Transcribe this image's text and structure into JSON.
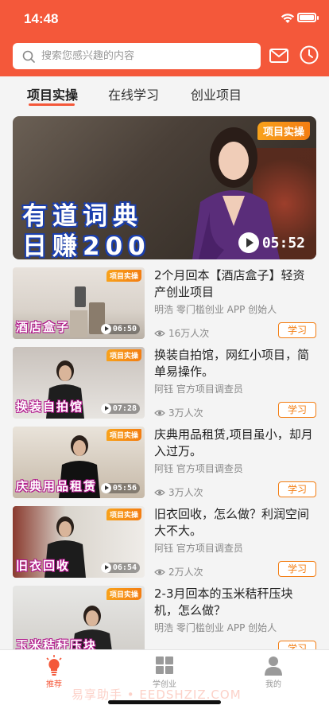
{
  "status_bar": {
    "time": "14:48"
  },
  "search": {
    "placeholder": "搜索您感兴趣的内容"
  },
  "tabs": [
    {
      "label": "项目实操",
      "active": true
    },
    {
      "label": "在线学习",
      "active": false
    },
    {
      "label": "创业项目",
      "active": false
    }
  ],
  "banner": {
    "tag": "项目实操",
    "title_line1": "有道词典",
    "title_line2": "日赚200",
    "duration": "05:52"
  },
  "items": [
    {
      "tag": "项目实操",
      "caption": "酒店盒子",
      "duration": "06:50",
      "title": "2个月回本【酒店盒子】轻资产创业项目",
      "author": "明浩 零门槛创业 APP 创始人",
      "views": "16万人次",
      "button": "学习"
    },
    {
      "tag": "项目实操",
      "caption": "换装自拍馆",
      "duration": "07:28",
      "title": "换装自拍馆，网红小项目，简单易操作。",
      "author": "阿钰 官方项目调查员",
      "views": "3万人次",
      "button": "学习"
    },
    {
      "tag": "项目实操",
      "caption": "庆典用品租赁",
      "duration": "05:56",
      "title": "庆典用品租赁,项目虽小，却月入过万。",
      "author": "阿钰 官方项目调查员",
      "views": "3万人次",
      "button": "学习"
    },
    {
      "tag": "项目实操",
      "caption": "旧衣回收",
      "duration": "06:54",
      "title": "旧衣回收，怎么做？利润空间大不大。",
      "author": "阿钰 官方项目调查员",
      "views": "2万人次",
      "button": "学习"
    },
    {
      "tag": "项目实操",
      "caption": "玉米秸秆压块",
      "duration": "",
      "title": "2-3月回本的玉米秸秆压块机，怎么做？",
      "author": "明浩 零门槛创业 APP 创始人",
      "views": "",
      "button": "学习"
    }
  ],
  "bottom_nav": [
    {
      "label": "推荐",
      "active": true
    },
    {
      "label": "学创业",
      "active": false
    },
    {
      "label": "我的",
      "active": false
    }
  ],
  "watermark": "易享助手 • EEDSHZIZ.COM",
  "colors": {
    "brand": "#f4583a",
    "accent": "#f37d12"
  }
}
